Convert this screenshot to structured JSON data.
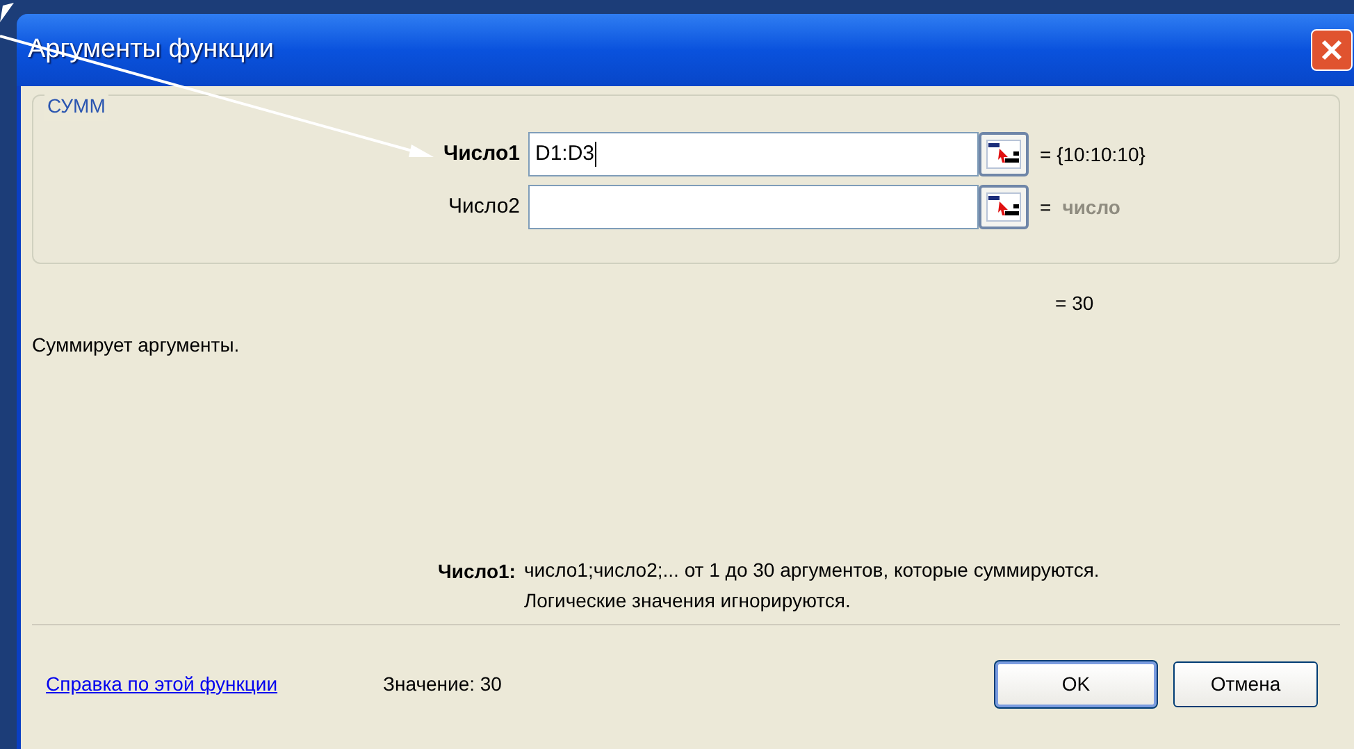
{
  "window": {
    "title": "Аргументы функции"
  },
  "function_group": {
    "name": "СУММ",
    "arguments": [
      {
        "label": "Число1",
        "value": "D1:D3",
        "result": "= {10:10:10}",
        "active": true,
        "result_is_hint": false
      },
      {
        "label": "Число2",
        "result_prefix": "=",
        "result": "число",
        "active": false,
        "result_is_hint": true
      }
    ]
  },
  "formula_result": "= 30",
  "description": "Суммирует аргументы.",
  "argument_help": {
    "label": "Число1:",
    "lines": [
      "число1;число2;... от 1 до 30 аргументов, которые суммируются.",
      "Логические значения игнорируются."
    ]
  },
  "footer": {
    "help_link": "Справка по этой функции",
    "value_text": "Значение: 30",
    "buttons": [
      {
        "label": "OK",
        "default": true
      },
      {
        "label": "Отмена",
        "default": false
      }
    ]
  }
}
